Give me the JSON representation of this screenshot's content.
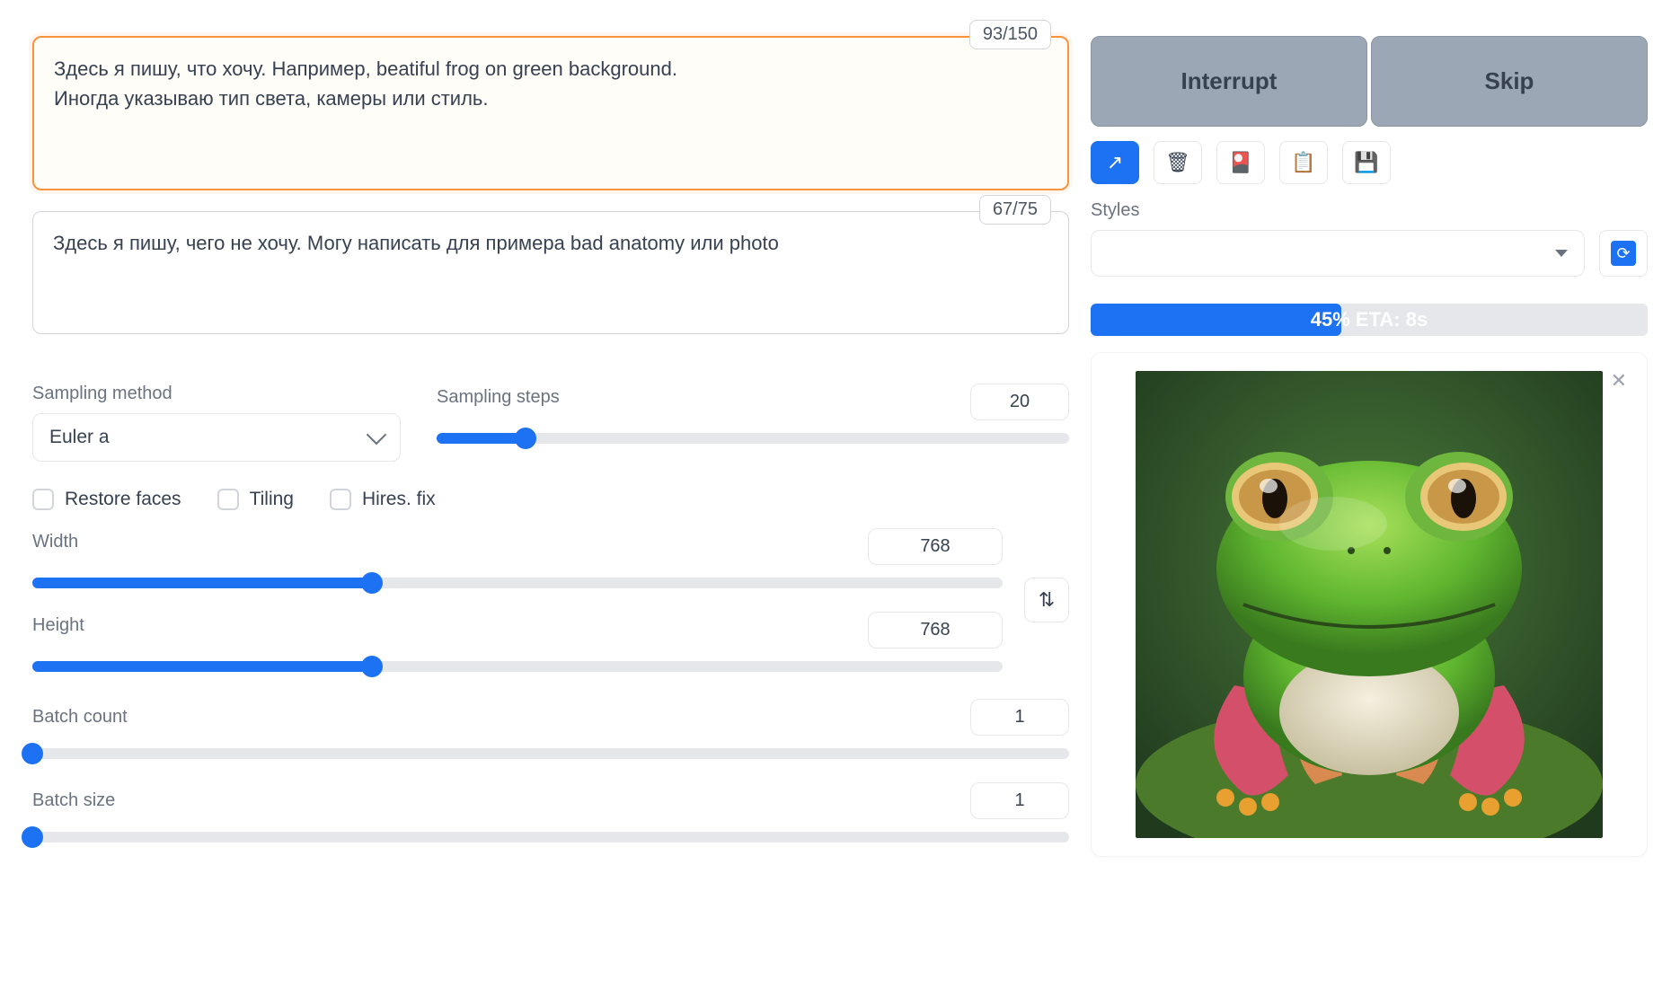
{
  "prompt": {
    "text": "Здесь я пишу, что хочу. Например, beatiful frog on green background.\nИногда указываю тип света, камеры или стиль.",
    "counter": "93/150"
  },
  "negative": {
    "text": "Здесь я пишу, чего не хочу. Могу написать для примера bad anatomy или photo",
    "counter": "67/75"
  },
  "sampling": {
    "method_label": "Sampling method",
    "method_value": "Euler a",
    "steps_label": "Sampling steps",
    "steps_value": "20",
    "steps_pct": 14
  },
  "checks": {
    "restore": "Restore faces",
    "tiling": "Tiling",
    "hires": "Hires. fix"
  },
  "dims": {
    "w_label": "Width",
    "w_value": "768",
    "w_pct": 35,
    "h_label": "Height",
    "h_value": "768",
    "h_pct": 35
  },
  "batch": {
    "count_label": "Batch count",
    "count_value": "1",
    "count_pct": 0,
    "size_label": "Batch size",
    "size_value": "1",
    "size_pct": 0
  },
  "actions": {
    "interrupt": "Interrupt",
    "skip": "Skip"
  },
  "styles": {
    "label": "Styles"
  },
  "progress": {
    "text": "45% ETA: 8s",
    "pct": 45
  },
  "icons": {
    "arrow": "↗",
    "trash": "🗑",
    "red": "🎴",
    "clip": "📋",
    "save": "💾",
    "refresh": "⟳",
    "swap": "⇅"
  }
}
